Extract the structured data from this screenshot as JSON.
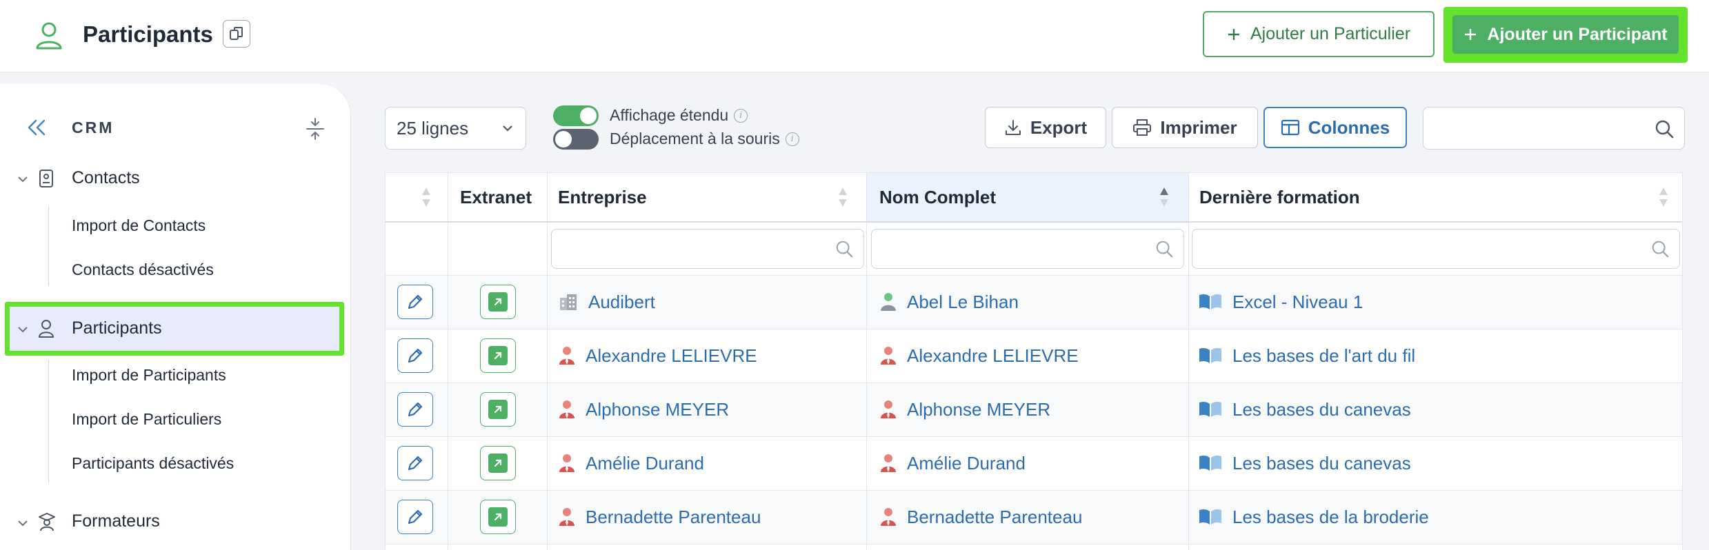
{
  "header": {
    "title": "Participants",
    "add_particulier_label": "Ajouter un Particulier",
    "add_participant_label": "Ajouter un Participant"
  },
  "sidebar": {
    "section": "CRM",
    "groups": [
      {
        "label": "Contacts",
        "icon": "contact-card-icon",
        "items": [
          "Import de Contacts",
          "Contacts désactivés"
        ]
      },
      {
        "label": "Participants",
        "icon": "user-icon",
        "active": true,
        "items": [
          "Import de Participants",
          "Import de Particuliers",
          "Participants désactivés"
        ]
      },
      {
        "label": "Formateurs",
        "icon": "trainer-icon",
        "items": []
      }
    ]
  },
  "toolbar": {
    "lines_value": "25 lignes",
    "toggle_extended": {
      "label": "Affichage étendu",
      "on": true
    },
    "toggle_mouse": {
      "label": "Déplacement à la souris",
      "on": false
    },
    "export_label": "Export",
    "print_label": "Imprimer",
    "columns_label": "Colonnes",
    "search_placeholder": ""
  },
  "table": {
    "columns": [
      "",
      "Extranet",
      "Entreprise",
      "Nom Complet",
      "Dernière formation"
    ],
    "rows": [
      {
        "entreprise": "Audibert",
        "entreprise_icon": "building-icon",
        "nom": "Abel Le Bihan",
        "nom_icon": "user-green-icon",
        "formation": "Excel - Niveau 1"
      },
      {
        "entreprise": "Alexandre LELIEVRE",
        "entreprise_icon": "person-red-icon",
        "nom": "Alexandre LELIEVRE",
        "nom_icon": "person-red-icon",
        "formation": "Les bases de l'art du fil"
      },
      {
        "entreprise": "Alphonse MEYER",
        "entreprise_icon": "person-red-icon",
        "nom": "Alphonse MEYER",
        "nom_icon": "person-red-icon",
        "formation": "Les bases du canevas"
      },
      {
        "entreprise": "Amélie Durand",
        "entreprise_icon": "person-red-icon",
        "nom": "Amélie Durand",
        "nom_icon": "person-red-icon",
        "formation": "Les bases du canevas"
      },
      {
        "entreprise": "Bernadette Parenteau",
        "entreprise_icon": "person-red-icon",
        "nom": "Bernadette Parenteau",
        "nom_icon": "person-red-icon",
        "formation": "Les bases de la broderie"
      }
    ]
  },
  "colors": {
    "accent_green": "#4caf63",
    "highlight_green": "#64e32d",
    "link_blue": "#2b6cb0",
    "sidebar_active": "#e8ebfb"
  }
}
